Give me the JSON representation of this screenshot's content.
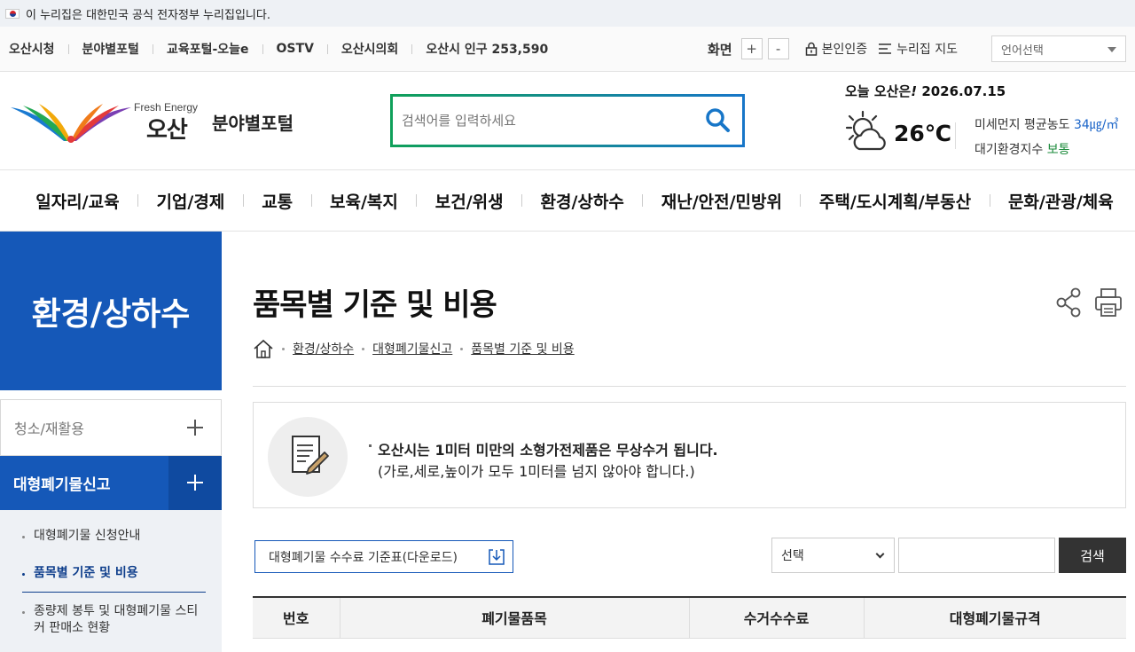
{
  "gov_banner": {
    "text": "이 누리집은 대한민국 공식 전자정부 누리집입니다."
  },
  "util": {
    "links": [
      "오산시청",
      "분야별포털",
      "교육포털-오늘e",
      "OSTV",
      "오산시의회",
      "오산시 인구 253,590"
    ],
    "zoom_label": "화면",
    "zoom_in": "+",
    "zoom_out": "-",
    "auth": "본인인증",
    "sitemap": "누리집 지도",
    "language": "언어선택"
  },
  "header": {
    "logo_fresh": "Fresh Energy",
    "logo_city": "오산",
    "portal": "분야별포털",
    "search_placeholder": "검색어를 입력하세요"
  },
  "weather": {
    "today_label": "오늘 오산은",
    "today_mark": "!",
    "date": "2026.07.15",
    "icon": "partly-cloudy-icon",
    "temp": "26℃",
    "dust_label": "미세먼지 평균농도",
    "dust_value": "34㎍/㎥",
    "air_label": "대기환경지수",
    "air_value": "보통"
  },
  "gnb": [
    "일자리/교육",
    "기업/경제",
    "교통",
    "보육/복지",
    "보건/위생",
    "환경/상하수",
    "재난/안전/민방위",
    "주택/도시계획/부동산",
    "문화/관광/체육"
  ],
  "side": {
    "title": "환경/상하수",
    "menu_1": "청소/재활용",
    "menu_2": "대형폐기물신고",
    "sub": [
      "대형폐기물 신청안내",
      "품목별 기준 및 비용",
      "종량제 봉투 및 대형폐기물 스티커 판매소 현황"
    ]
  },
  "page": {
    "title": "품목별 기준 및 비용",
    "breadcrumb": [
      "환경/상하수",
      "대형폐기물신고",
      "품목별 기준 및 비용"
    ],
    "notice_bold": "오산시는 1미터 미만의 소형가전제품은 무상수거 됩니다.",
    "notice_sub": "(가로,세로,높이가 모두 1미터를 넘지 않아야 합니다.)",
    "download": "대형폐기물 수수료 기준표(다운로드)",
    "select": "선택",
    "search_btn": "검색"
  },
  "table": {
    "headers": [
      "번호",
      "폐기물품목",
      "수거수수료",
      "대형폐기물규격"
    ]
  },
  "colors": {
    "brand_blue": "#1558b8",
    "brand_green": "#10a05a",
    "search_blue": "#1776c8"
  }
}
